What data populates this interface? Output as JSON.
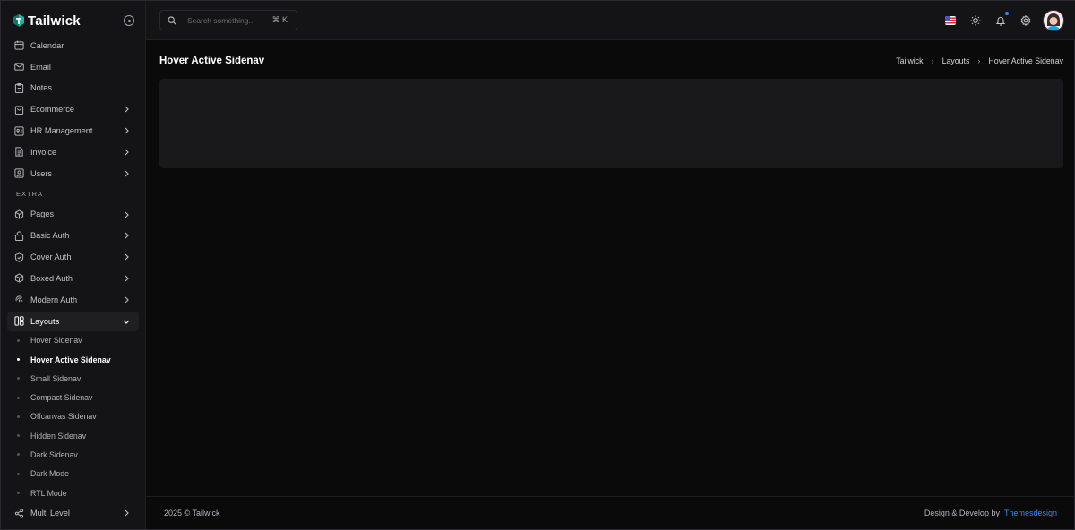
{
  "app": {
    "name": "Tailwick"
  },
  "sidebar": {
    "items": [
      {
        "label": "Calendar",
        "icon": "calendar-icon",
        "has_children": false
      },
      {
        "label": "Email",
        "icon": "mail-icon",
        "has_children": false
      },
      {
        "label": "Notes",
        "icon": "clipboard-icon",
        "has_children": false
      },
      {
        "label": "Ecommerce",
        "icon": "shopping-bag-icon",
        "has_children": true
      },
      {
        "label": "HR Management",
        "icon": "id-card-icon",
        "has_children": true
      },
      {
        "label": "Invoice",
        "icon": "file-text-icon",
        "has_children": true
      },
      {
        "label": "Users",
        "icon": "user-square-icon",
        "has_children": true
      }
    ],
    "extra_title": "EXTRA",
    "extra_items": [
      {
        "label": "Pages",
        "icon": "boxes-icon"
      },
      {
        "label": "Basic Auth",
        "icon": "lock-icon"
      },
      {
        "label": "Cover Auth",
        "icon": "shield-check-icon"
      },
      {
        "label": "Boxed Auth",
        "icon": "box-icon"
      },
      {
        "label": "Modern Auth",
        "icon": "fingerprint-icon"
      }
    ],
    "layouts": {
      "label": "Layouts",
      "icon": "layout-icon",
      "children": [
        {
          "label": "Hover Sidenav",
          "active": false
        },
        {
          "label": "Hover Active Sidenav",
          "active": true
        },
        {
          "label": "Small Sidenav",
          "active": false
        },
        {
          "label": "Compact Sidenav",
          "active": false
        },
        {
          "label": "Offcanvas Sidenav",
          "active": false
        },
        {
          "label": "Hidden Sidenav",
          "active": false
        },
        {
          "label": "Dark Sidenav",
          "active": false
        },
        {
          "label": "Dark Mode",
          "active": false
        },
        {
          "label": "RTL Mode",
          "active": false
        }
      ]
    },
    "multi_level": {
      "label": "Multi Level",
      "icon": "share-icon"
    }
  },
  "topbar": {
    "search_placeholder": "Search something...",
    "search_shortcut": "⌘ K"
  },
  "page": {
    "title": "Hover Active Sidenav",
    "breadcrumb": [
      "Tailwick",
      "Layouts",
      "Hover Active Sidenav"
    ]
  },
  "footer": {
    "copyright": "2025 © Tailwick",
    "credit_text": "Design & Develop by",
    "credit_link": "Themesdesign"
  },
  "colors": {
    "accent": "#3b82f6",
    "background": "#0a0a0b",
    "sidebar": "#141416"
  }
}
